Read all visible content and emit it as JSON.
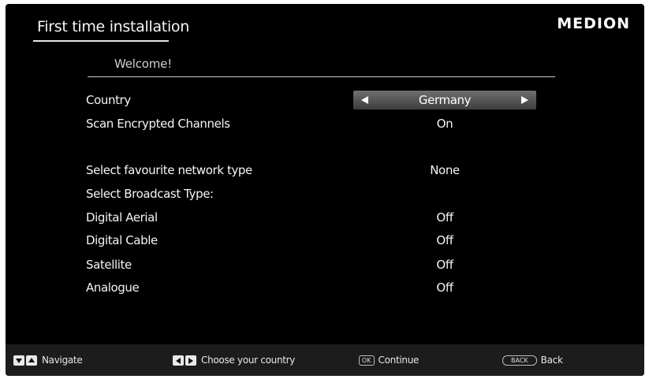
{
  "header": {
    "title": "First time installation",
    "brand": "MEDION"
  },
  "subtitle": "Welcome!",
  "settings": {
    "country": {
      "label": "Country",
      "value": "Germany"
    },
    "scan_encrypted": {
      "label": "Scan Encrypted Channels",
      "value": "On"
    },
    "favourite_network": {
      "label": "Select favourite network type",
      "value": "None"
    },
    "broadcast_type": {
      "label": "Select Broadcast Type:"
    },
    "digital_aerial": {
      "label": "Digital Aerial",
      "value": "Off"
    },
    "digital_cable": {
      "label": "Digital Cable",
      "value": "Off"
    },
    "satellite": {
      "label": "Satellite",
      "value": "Off"
    },
    "analogue": {
      "label": "Analogue",
      "value": "Off"
    }
  },
  "footer": {
    "navigate": "Navigate",
    "choose_country": "Choose your country",
    "ok_key": "OK",
    "continue": "Continue",
    "back_key": "BACK",
    "back": "Back"
  },
  "icons": {
    "down": "arrow-down-icon",
    "up": "arrow-up-icon",
    "left": "arrow-left-icon",
    "right": "arrow-right-icon"
  },
  "colors": {
    "background": "#000000",
    "footer_bar": "#1c1c1c",
    "selector_top": "#6f6f6f",
    "selector_bottom": "#3d3d3d",
    "text": "#f5f5f5"
  }
}
